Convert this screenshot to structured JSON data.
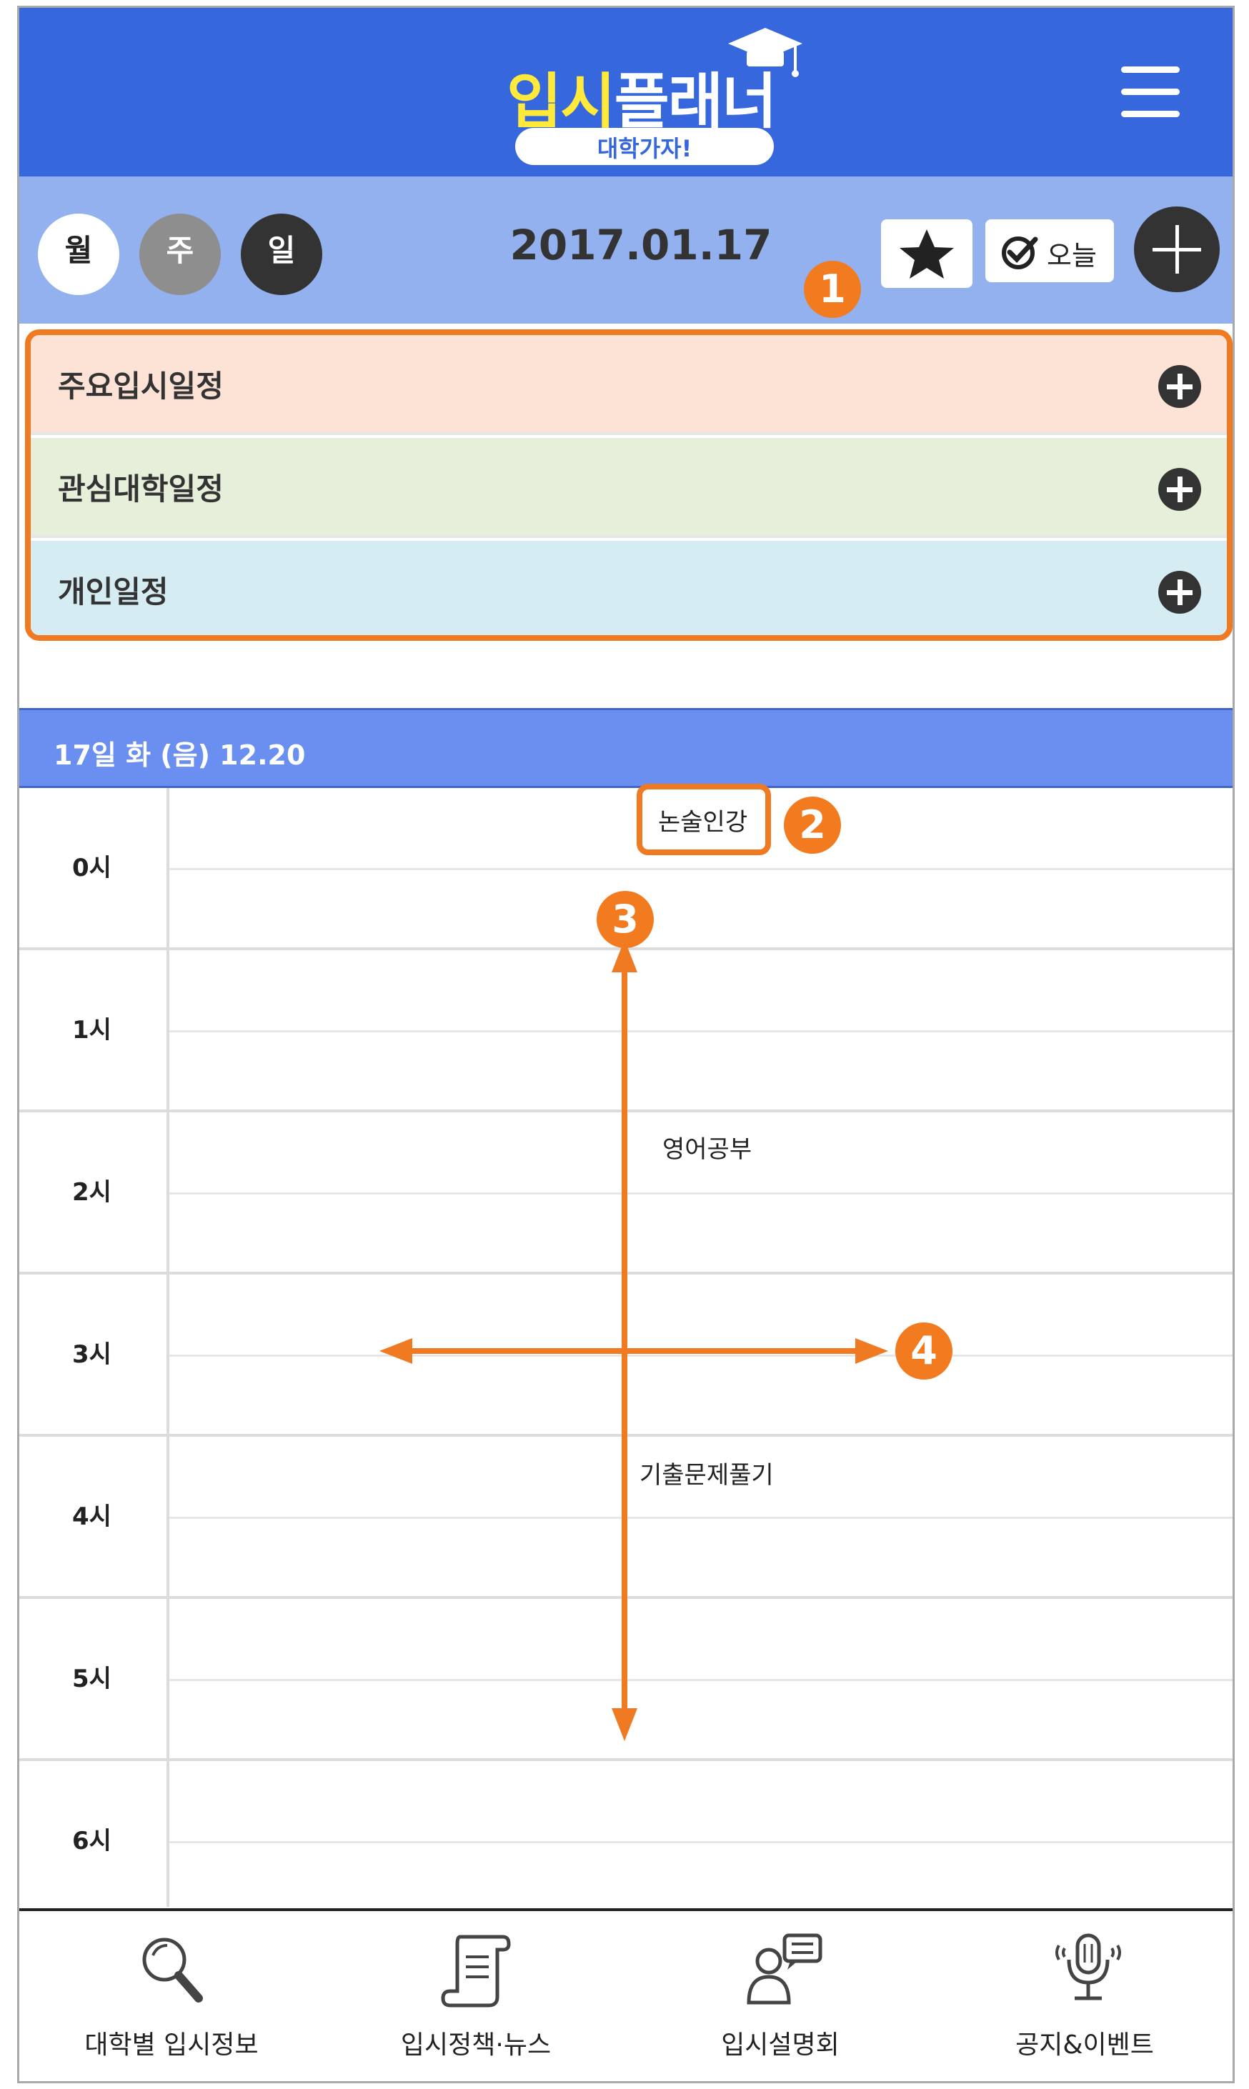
{
  "header": {
    "logo_main_highlight": "입시",
    "logo_main_rest": "플래너",
    "logo_sub": "대학가자!"
  },
  "datebar": {
    "view_month": "월",
    "view_week": "주",
    "view_day": "일",
    "date": "2017.01.17",
    "today_label": "오늘"
  },
  "categories": [
    {
      "label": "주요입시일정"
    },
    {
      "label": "관심대학일정"
    },
    {
      "label": "개인일정"
    }
  ],
  "day_header": "17일 화 (음) 12.20",
  "hours": [
    "0시",
    "1시",
    "2시",
    "3시",
    "4시",
    "5시",
    "6시"
  ],
  "events": [
    {
      "label": "논술인강"
    },
    {
      "label": "영어공부"
    },
    {
      "label": "기출문제풀기"
    }
  ],
  "annotations": [
    "1",
    "2",
    "3",
    "4"
  ],
  "bottom_nav": [
    {
      "label": "대학별 입시정보",
      "icon": "magnifier-icon"
    },
    {
      "label": "입시정책·뉴스",
      "icon": "scroll-icon"
    },
    {
      "label": "입시설명회",
      "icon": "person-speech-icon"
    },
    {
      "label": "공지&이벤트",
      "icon": "microphone-icon"
    }
  ],
  "colors": {
    "header_blue": "#3667dd",
    "datebar_blue": "#92b1ee",
    "accent_orange": "#f07a22",
    "cat_major": "#fde2d6",
    "cat_interest": "#e5efd9",
    "cat_personal": "#d5edf2"
  }
}
